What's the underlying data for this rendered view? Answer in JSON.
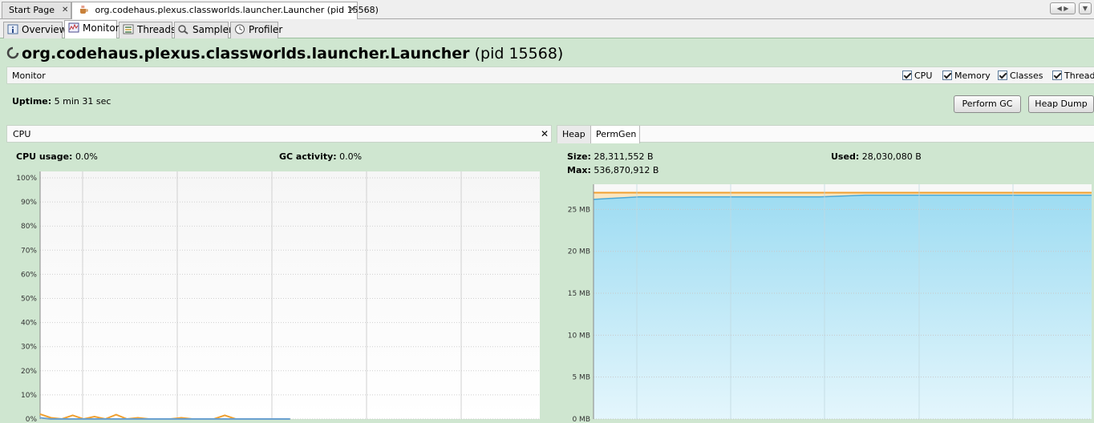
{
  "doc_tabs": [
    {
      "label": "Start Page",
      "active": false
    },
    {
      "label": "org.codehaus.plexus.classworlds.launcher.Launcher (pid 15568)",
      "active": true
    }
  ],
  "view_tabs": [
    {
      "label": "Overview",
      "icon": "info-icon"
    },
    {
      "label": "Monitor",
      "icon": "monitor-icon"
    },
    {
      "label": "Threads",
      "icon": "threads-icon"
    },
    {
      "label": "Sampler",
      "icon": "sampler-icon"
    },
    {
      "label": "Profiler",
      "icon": "profiler-icon"
    }
  ],
  "active_view_tab": "Monitor",
  "title": {
    "app": "org.codehaus.plexus.classworlds.launcher.Launcher",
    "pid": "(pid 15568)"
  },
  "monitor": {
    "label": "Monitor",
    "checkboxes": [
      {
        "label": "CPU",
        "checked": true
      },
      {
        "label": "Memory",
        "checked": true
      },
      {
        "label": "Classes",
        "checked": true
      },
      {
        "label": "Threads",
        "checked": true
      }
    ]
  },
  "uptime": {
    "label": "Uptime:",
    "value": "5 min 31 sec"
  },
  "buttons": {
    "perform_gc": "Perform GC",
    "heap_dump": "Heap Dump"
  },
  "cpu_panel": {
    "title": "CPU",
    "cpu_usage_label": "CPU usage:",
    "cpu_usage_value": "0.0%",
    "gc_label": "GC activity:",
    "gc_value": "0.0%"
  },
  "memory_panel": {
    "tabs": [
      "Heap",
      "PermGen"
    ],
    "active_tab": "PermGen",
    "size_label": "Size:",
    "size_value": "28,311,552 B",
    "used_label": "Used:",
    "used_value": "28,030,080 B",
    "max_label": "Max:",
    "max_value": "536,870,912 B"
  },
  "colors": {
    "background": "#cfe6d0",
    "cpu_line": "#f0a030",
    "gc_line": "#6aa0d0",
    "used_fill": "#a4ddf0",
    "size_line": "#f0a030"
  },
  "chart_data": [
    {
      "type": "line",
      "title": "CPU",
      "ylim": [
        0,
        100
      ],
      "y_ticks": [
        "100%",
        "90%",
        "80%",
        "70%",
        "60%",
        "50%",
        "40%",
        "30%",
        "20%",
        "10%",
        "0%"
      ],
      "series": [
        {
          "name": "CPU usage",
          "values": [
            2.0,
            0.5,
            0.0,
            1.5,
            0.0,
            1.0,
            0.0,
            1.8,
            0.0,
            0.5,
            0.0,
            0.0,
            0.0,
            0.5,
            0.0,
            0.0,
            0.0,
            1.5,
            0.0,
            0.0,
            0.0,
            0.0,
            0.0,
            0.0
          ]
        },
        {
          "name": "GC activity",
          "values": [
            0.5,
            0,
            0,
            0,
            0,
            0,
            0,
            0,
            0,
            0,
            0,
            0,
            0,
            0,
            0,
            0,
            0,
            0,
            0,
            0,
            0,
            0,
            0,
            0
          ]
        }
      ]
    },
    {
      "type": "area",
      "title": "PermGen",
      "ylim": [
        0,
        28
      ],
      "y_ticks": [
        "25 MB",
        "20 MB",
        "15 MB",
        "10 MB",
        "5 MB",
        "0 MB"
      ],
      "y_tick_values": [
        25,
        20,
        15,
        10,
        5,
        0
      ],
      "series": [
        {
          "name": "Size",
          "values": [
            27.0,
            27.0,
            27.0,
            27.0,
            27.0,
            27.0,
            27.0,
            27.0,
            27.0,
            27.0,
            27.0,
            27.0
          ]
        },
        {
          "name": "Used",
          "values": [
            26.2,
            26.5,
            26.5,
            26.5,
            26.5,
            26.5,
            26.7,
            26.7,
            26.7,
            26.7,
            26.7,
            26.7
          ]
        }
      ]
    }
  ]
}
